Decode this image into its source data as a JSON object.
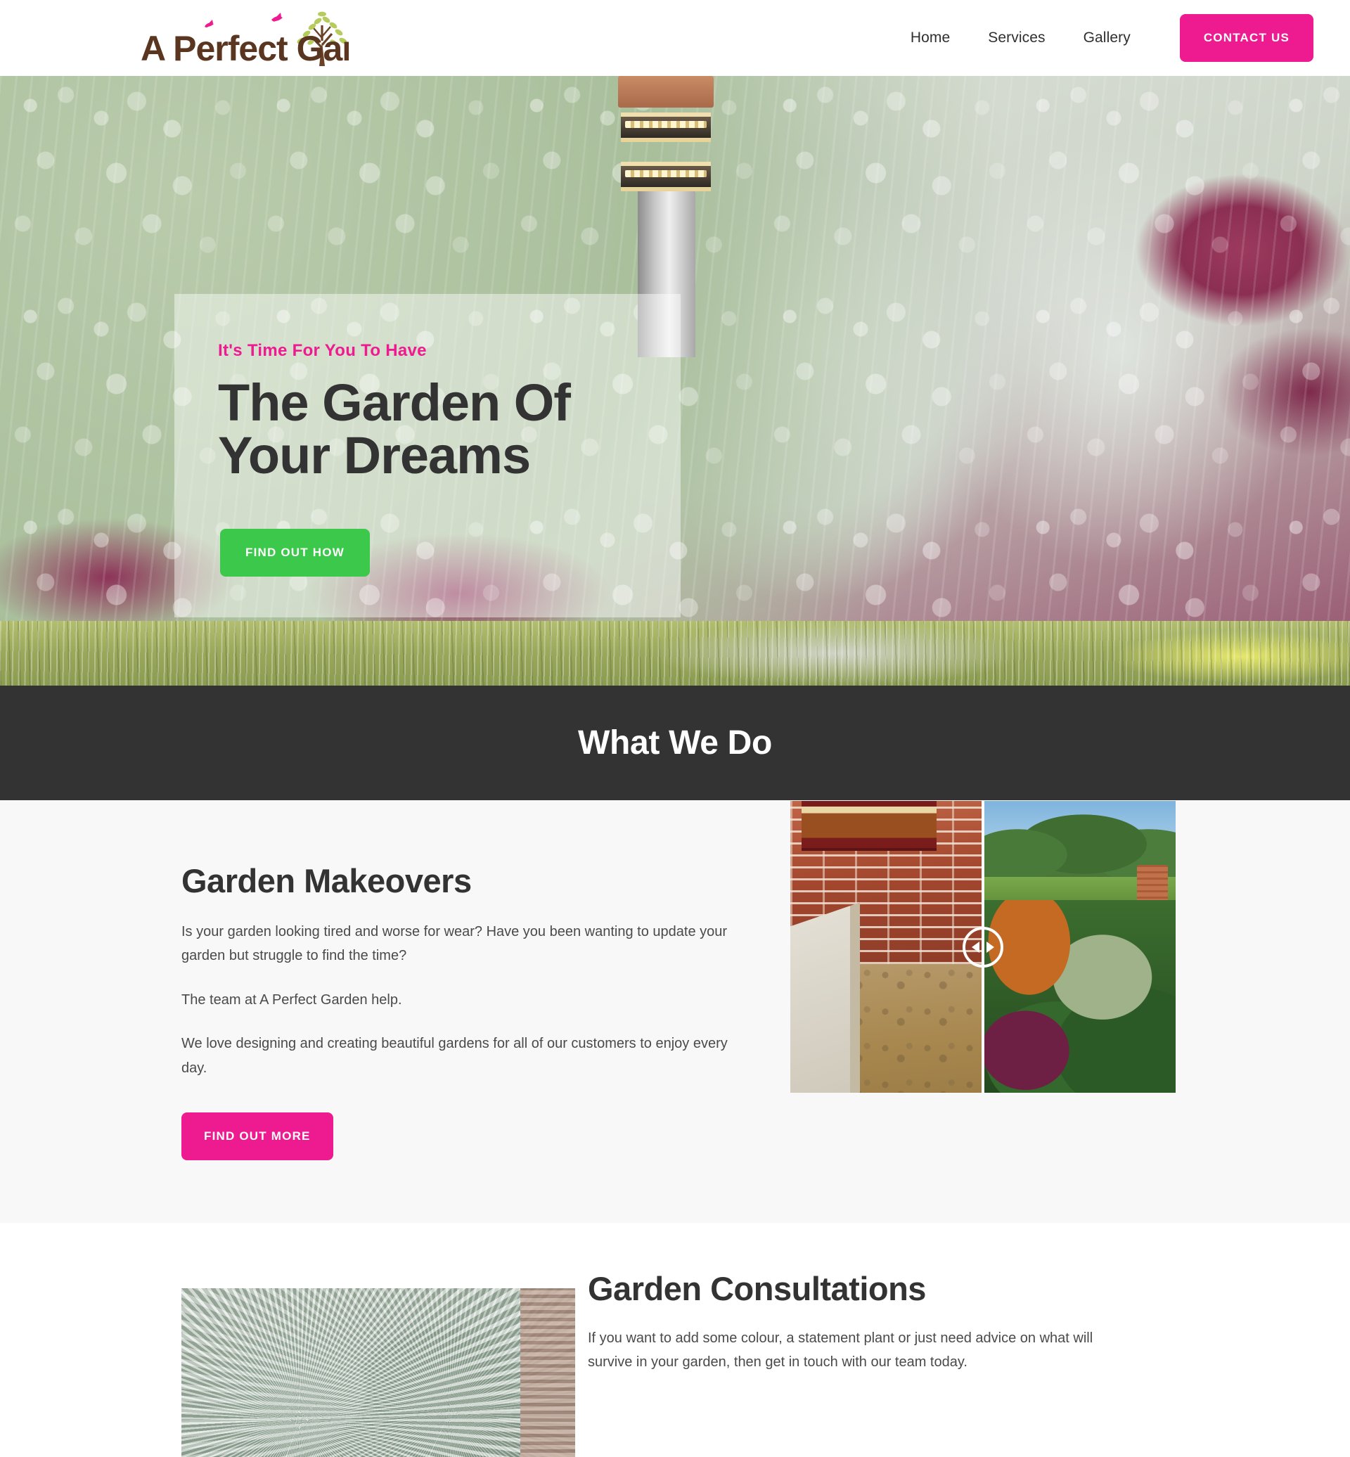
{
  "header": {
    "logo": {
      "name": "A Perfect Garden",
      "word1": "A Perfect",
      "word2": "Garden",
      "tree_icon": "tree-icon",
      "bird_icon": "bird-icon",
      "brand_brown": "#5a3520",
      "brand_pink": "#ED1A90",
      "leaf_green": "#a9c24a"
    },
    "nav": [
      {
        "label": "Home",
        "name": "nav-link-home"
      },
      {
        "label": "Services",
        "name": "nav-link-services"
      },
      {
        "label": "Gallery",
        "name": "nav-link-gallery"
      }
    ],
    "contact_button": "CONTACT US"
  },
  "hero": {
    "kicker": "It's Time For You To Have",
    "title_line1": "The Garden Of",
    "title_line2": "Your Dreams",
    "cta": "FIND OUT HOW",
    "cta_color": "#3CC84A",
    "kicker_color": "#ED1A90",
    "image_alt": "garden-bed-with-bollard-light"
  },
  "band": {
    "title": "What We Do",
    "bg": "#333333"
  },
  "makeovers": {
    "heading": "Garden Makeovers",
    "paragraphs": [
      "Is your garden looking tired and worse for wear? Have you been wanting to update your garden but struggle to find the time?",
      "The team at A Perfect Garden help.",
      "We love designing and creating beautiful gardens for all of our customers to enjoy every day."
    ],
    "cta": "FIND OUT MORE",
    "cta_color": "#ED1A90",
    "before_after": {
      "before_alt": "before-bare-dirt-beside-brick-wall",
      "after_alt": "after-planted-garden-bed",
      "handle": "compare-slider-handle",
      "position_percent": 50
    },
    "bg": "#F8F8F8"
  },
  "consultations": {
    "heading": "Garden Consultations",
    "paragraphs": [
      "If you want to add some colour, a statement plant or just need advice on what will survive in your garden, then get in touch with our team today."
    ],
    "image_alt": "silver-fan-palm-foliage",
    "bg": "#FFFFFF"
  }
}
